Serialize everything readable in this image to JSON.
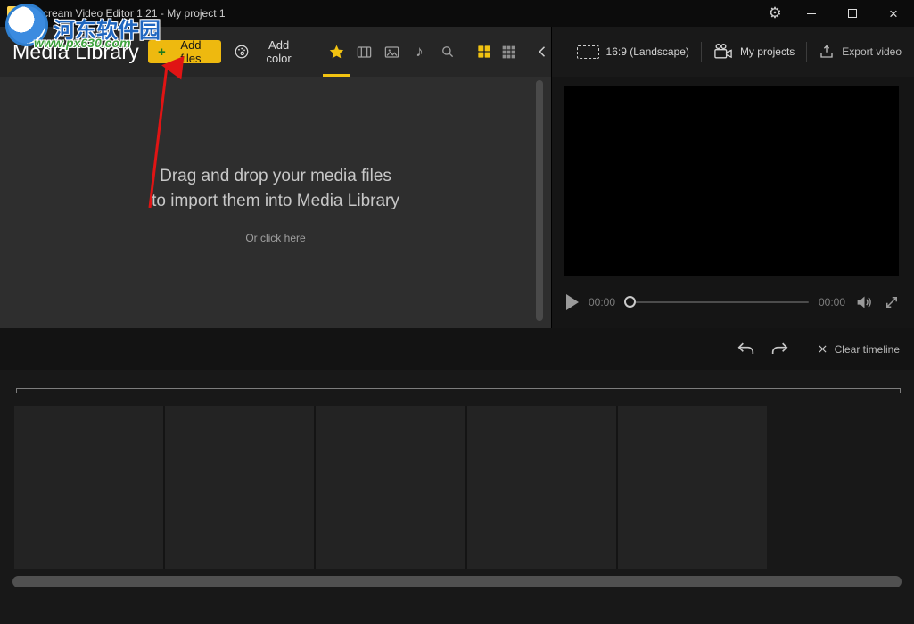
{
  "window": {
    "title": "Icecream Video Editor 1.21 - My project 1"
  },
  "watermark": {
    "site_name": "河东软件园",
    "site_url": "www.px630.com"
  },
  "toolbar": {
    "title": "Media Library",
    "add_files_plus": "+",
    "add_files": "Add files",
    "add_color": "Add color"
  },
  "project_bar": {
    "aspect": "16:9 (Landscape)",
    "my_projects": "My projects",
    "export_video": "Export video"
  },
  "dropzone": {
    "line1": "Drag and drop your media files",
    "line2": "to import them into Media Library",
    "hint": "Or click here"
  },
  "player": {
    "elapsed": "00:00",
    "duration": "00:00"
  },
  "timeline_bar": {
    "clear": "Clear timeline"
  },
  "colors": {
    "accent": "#f2c311",
    "button_yellow": "#eeb90f",
    "arrow_red": "#e01414"
  }
}
